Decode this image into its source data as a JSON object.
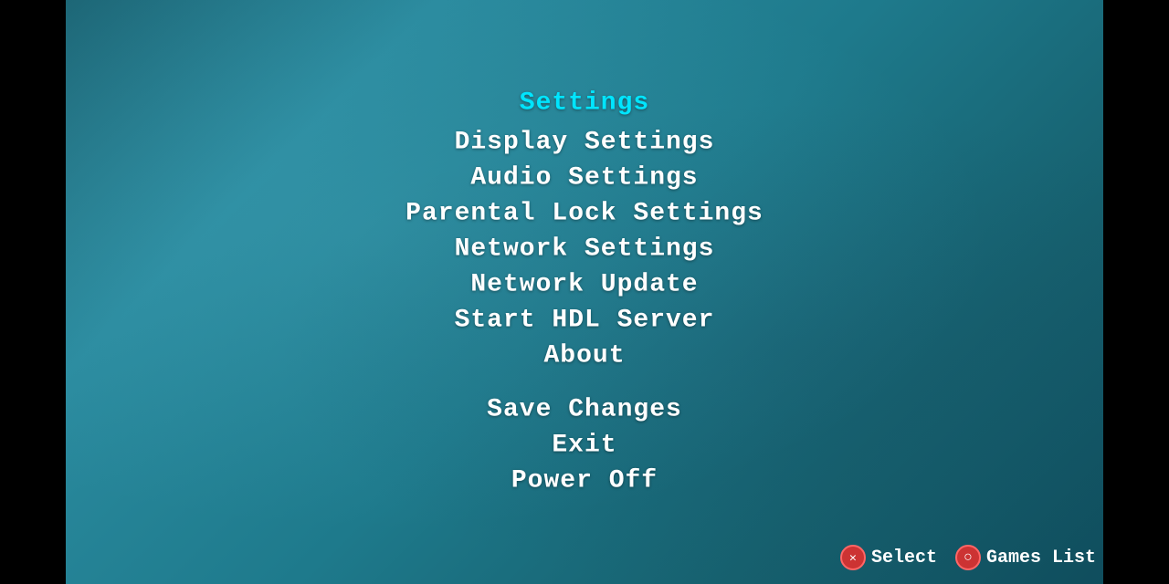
{
  "screen": {
    "background": {
      "left_bar": "#000000",
      "right_bar": "#000000",
      "main_gradient_start": "#1a5f6e",
      "main_gradient_end": "#0e4a5a"
    }
  },
  "menu": {
    "title": "Settings",
    "items": [
      {
        "id": "display-settings",
        "label": "Display  Settings",
        "active": false
      },
      {
        "id": "audio-settings",
        "label": "Audio  Settings",
        "active": false
      },
      {
        "id": "parental-lock-settings",
        "label": "Parental  Lock  Settings",
        "active": false
      },
      {
        "id": "network-settings",
        "label": "Network  Settings",
        "active": false
      },
      {
        "id": "network-update",
        "label": "Network  Update",
        "active": true
      },
      {
        "id": "start-hdl-server",
        "label": "Start  HDL  Server",
        "active": false
      },
      {
        "id": "about",
        "label": "About",
        "active": false
      }
    ],
    "actions": [
      {
        "id": "save-changes",
        "label": "Save  Changes"
      },
      {
        "id": "exit",
        "label": "Exit"
      },
      {
        "id": "power-off",
        "label": "Power  Off"
      }
    ]
  },
  "controls": {
    "select": {
      "button": "X",
      "label": "Select"
    },
    "games_list": {
      "button": "O",
      "label": "Games List"
    }
  }
}
